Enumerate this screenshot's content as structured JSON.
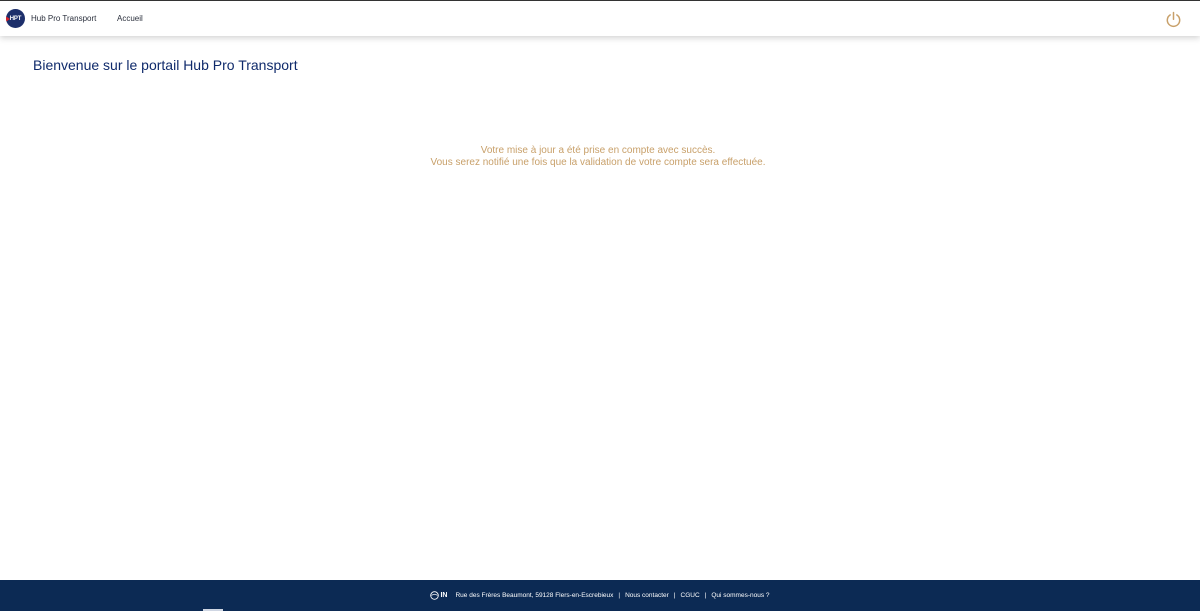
{
  "header": {
    "logo_text": "HPT",
    "brand_name": "Hub Pro Transport",
    "nav_home": "Accueil",
    "power_icon": "power-icon"
  },
  "main": {
    "title": "Bienvenue sur le portail Hub Pro Transport",
    "message_line1": "Votre mise à jour a été prise en compte avec succès.",
    "message_line2": "Vous serez notifié une fois que la validation de votre compte sera effectuée."
  },
  "footer": {
    "logo_text": "IN",
    "address": "Rue des Frères Beaumont, 59128 Flers-en-Escrebieux",
    "separator": "|",
    "contact": "Nous contacter",
    "cguc": "CGUC",
    "about": "Qui sommes-nous ?"
  },
  "colors": {
    "title": "#0f2a6b",
    "message": "#c8a06a",
    "footer_bg": "#0c2a54",
    "power_icon": "#c8a06a",
    "logo_bg": "#1d2f6b",
    "logo_accent": "#d8222a"
  }
}
